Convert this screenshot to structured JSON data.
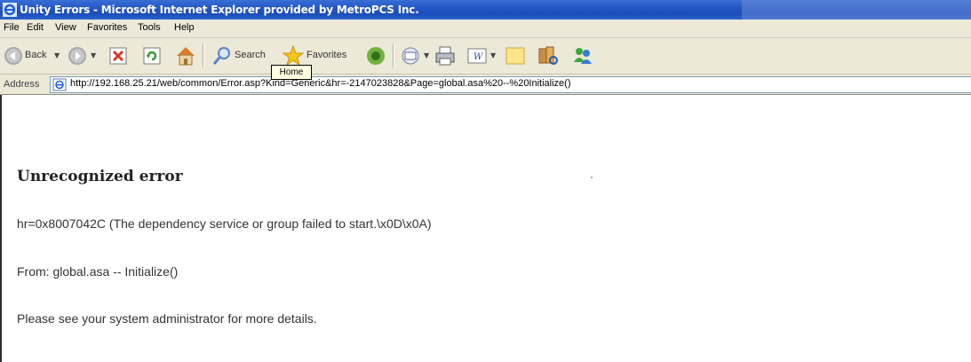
{
  "window": {
    "title": "Unity Errors - Microsoft Internet Explorer provided by MetroPCS Inc."
  },
  "menu": [
    "File",
    "Edit",
    "View",
    "Favorites",
    "Tools",
    "Help"
  ],
  "toolbar": {
    "back_label": "Back",
    "search_label": "Search",
    "favorites_label": "Favorites",
    "home_tooltip": "Home",
    "icons": [
      "back-icon",
      "forward-icon",
      "stop-icon",
      "refresh-icon",
      "home-icon",
      "search-icon",
      "favorites-icon",
      "media-icon",
      "mail-icon",
      "print-icon",
      "edit-icon",
      "discuss-icon",
      "research-icon",
      "messenger-icon"
    ]
  },
  "address": {
    "label": "Address",
    "url": "http://192.168.25.21/web/common/Error.asp?Kind=Generic&hr=-2147023828&Page=global.asa%20--%20Initialize()"
  },
  "content": {
    "heading": "Unrecognized error",
    "hr_line": "hr=0x8007042C (The dependency service or group failed to start.\\x0D\\x0A)",
    "from_line": "From: global.asa -- Initialize()",
    "help_line": "Please see your system administrator for more details."
  },
  "colors": {
    "title_bar": "#2457c5",
    "chrome": "#ece9d8",
    "tooltip": "#ffffe1"
  }
}
